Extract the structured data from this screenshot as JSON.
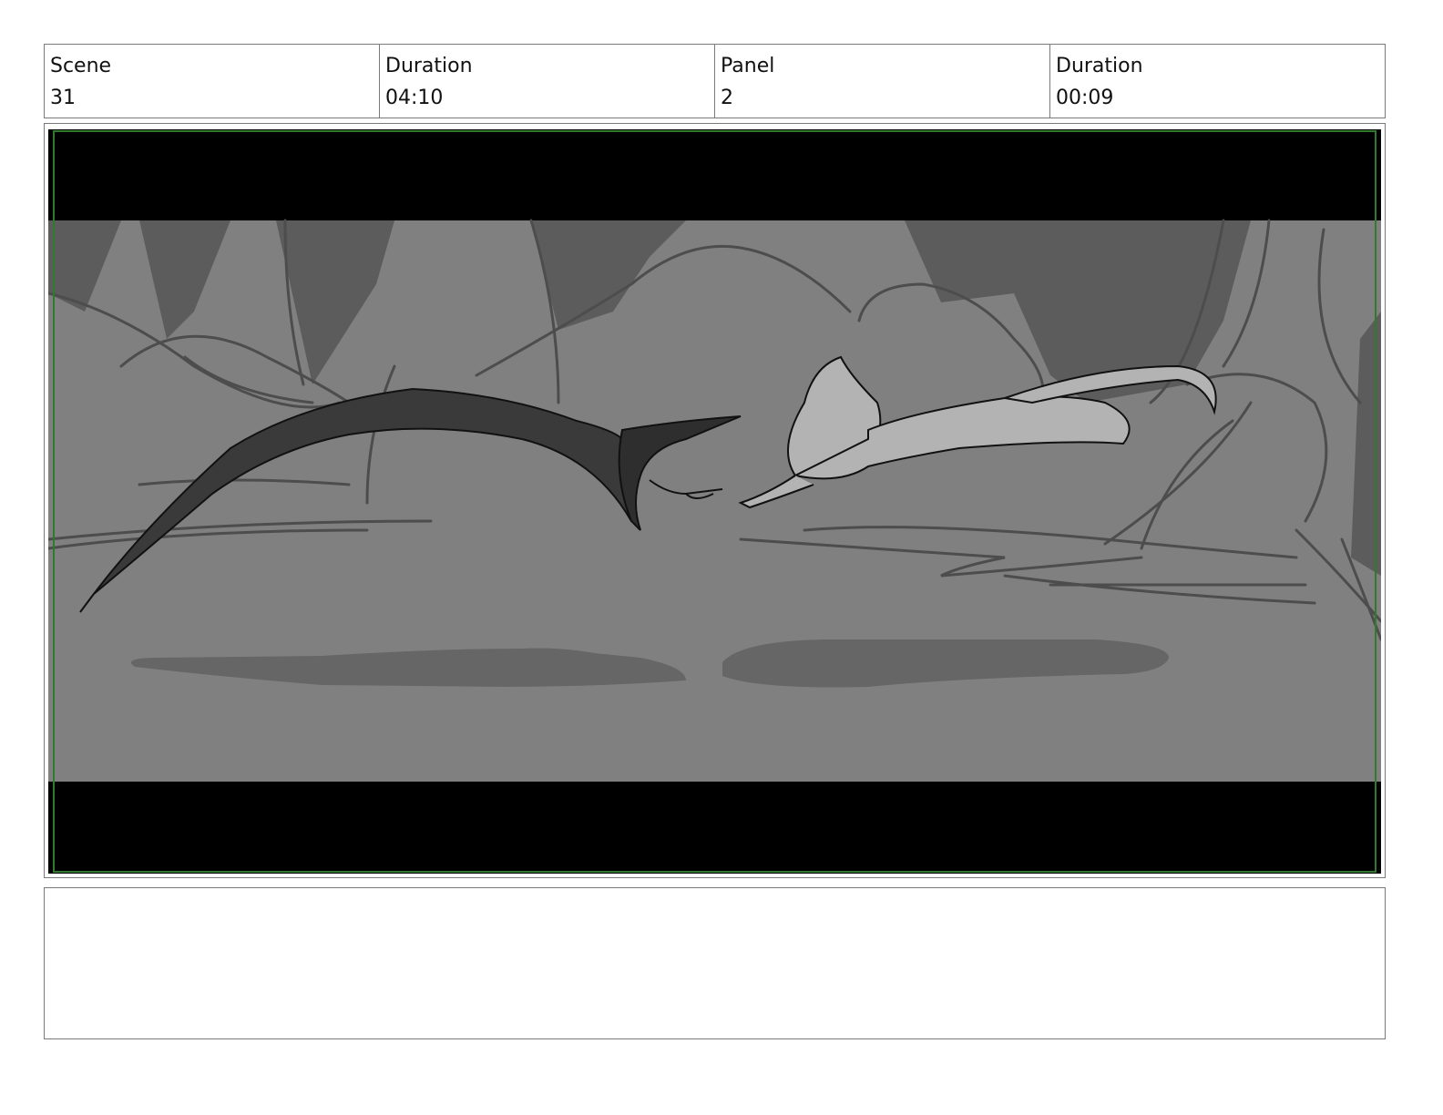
{
  "header": {
    "scene": {
      "label": "Scene",
      "value": "31"
    },
    "scene_duration": {
      "label": "Duration",
      "value": "04:10"
    },
    "panel": {
      "label": "Panel",
      "value": "2"
    },
    "panel_duration": {
      "label": "Duration",
      "value": "00:09"
    }
  },
  "panel_image": {
    "description_icon": "storyboard-sketch",
    "colors": {
      "letterbox": "#000000",
      "background": "#808080",
      "dark_rock": "#5c5c5c",
      "shadow": "#666666",
      "creature": "#3a3a3a",
      "cat": "#b3b3b3",
      "safe_frame": "#2f7a2f"
    }
  },
  "notes": {
    "text": ""
  }
}
